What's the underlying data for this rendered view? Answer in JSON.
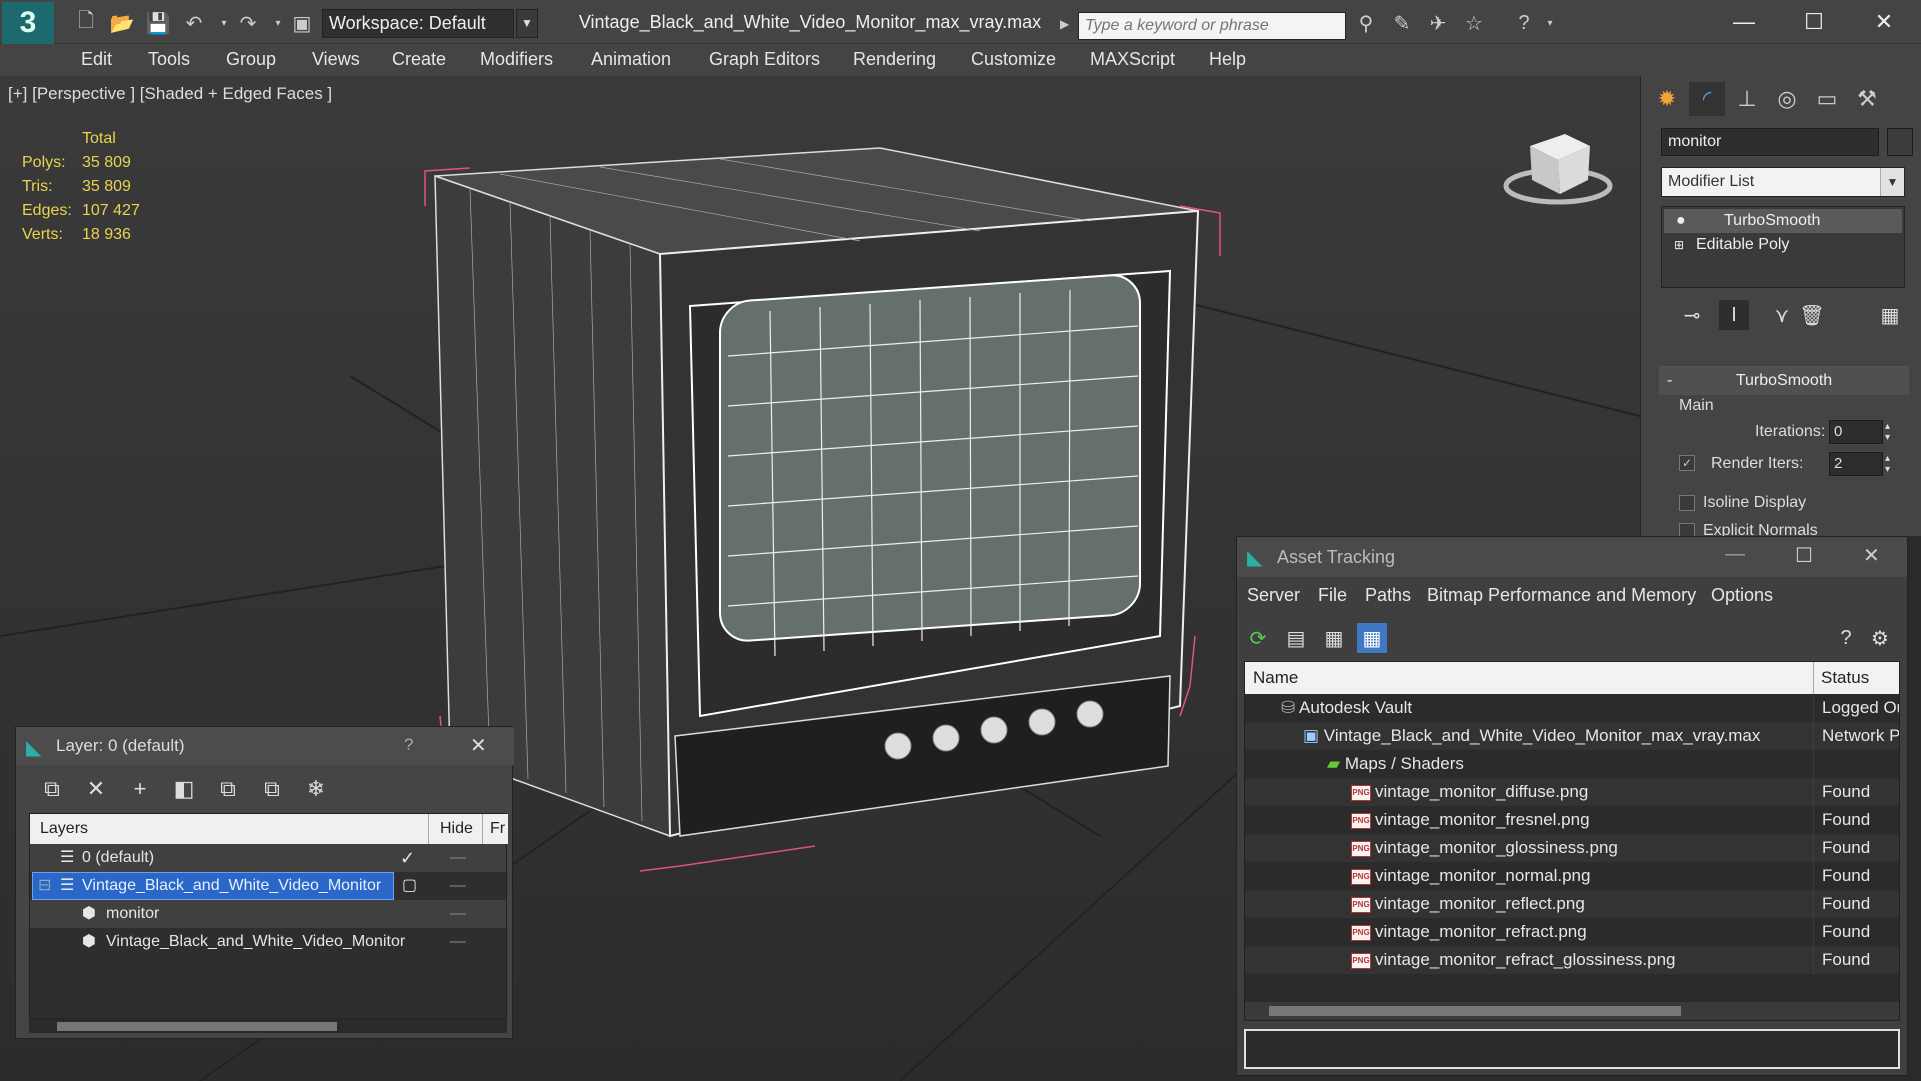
{
  "titlebar": {
    "workspace": "Workspace: Default",
    "title": "Vintage_Black_and_White_Video_Monitor_max_vray.max",
    "search_placeholder": "Type a keyword or phrase"
  },
  "menu": [
    "Edit",
    "Tools",
    "Group",
    "Views",
    "Create",
    "Modifiers",
    "Animation",
    "Graph Editors",
    "Rendering",
    "Customize",
    "MAXScript",
    "Help"
  ],
  "viewport": {
    "label": "[+] [Perspective ] [Shaded + Edged Faces ]",
    "stats": {
      "total_label": "Total",
      "polys_label": "Polys:",
      "polys": "35 809",
      "tris_label": "Tris:",
      "tris": "35 809",
      "edges_label": "Edges:",
      "edges": "107 427",
      "verts_label": "Verts:",
      "verts": "18 936"
    }
  },
  "command_panel": {
    "object_name": "monitor",
    "modifier_list": "Modifier List",
    "stack": [
      "TurboSmooth",
      "Editable Poly"
    ],
    "turbosmooth": {
      "title": "TurboSmooth",
      "collapse": "-",
      "main": "Main",
      "iterations_label": "Iterations:",
      "iterations": "0",
      "render_iters_label": "Render Iters:",
      "render_iters": "2",
      "isoline_label": "Isoline Display",
      "explicit_label": "Explicit Normals"
    }
  },
  "layer_panel": {
    "title": "Layer: 0 (default)",
    "help": "?",
    "col_layers": "Layers",
    "col_hide": "Hide",
    "col_fr": "Fr",
    "rows": [
      {
        "name": "0 (default)",
        "current": true
      },
      {
        "name": "Vintage_Black_and_White_Video_Monitor",
        "selected": true
      },
      {
        "name": "monitor"
      },
      {
        "name": "Vintage_Black_and_White_Video_Monitor"
      }
    ]
  },
  "asset_tracking": {
    "title": "Asset Tracking",
    "menu": [
      "Server",
      "File",
      "Paths",
      "Bitmap Performance and Memory",
      "Options"
    ],
    "col_name": "Name",
    "col_status": "Status",
    "rows": [
      {
        "name": "Autodesk Vault",
        "status": "Logged Out",
        "indent": 1,
        "icon": "vault"
      },
      {
        "name": "Vintage_Black_and_White_Video_Monitor_max_vray.max",
        "status": "Network Path",
        "indent": 2,
        "icon": "max"
      },
      {
        "name": "Maps / Shaders",
        "status": "",
        "indent": 3,
        "icon": "maps"
      },
      {
        "name": "vintage_monitor_diffuse.png",
        "status": "Found",
        "indent": 4,
        "icon": "png"
      },
      {
        "name": "vintage_monitor_fresnel.png",
        "status": "Found",
        "indent": 4,
        "icon": "png"
      },
      {
        "name": "vintage_monitor_glossiness.png",
        "status": "Found",
        "indent": 4,
        "icon": "png"
      },
      {
        "name": "vintage_monitor_normal.png",
        "status": "Found",
        "indent": 4,
        "icon": "png"
      },
      {
        "name": "vintage_monitor_reflect.png",
        "status": "Found",
        "indent": 4,
        "icon": "png"
      },
      {
        "name": "vintage_monitor_refract.png",
        "status": "Found",
        "indent": 4,
        "icon": "png"
      },
      {
        "name": "vintage_monitor_refract_glossiness.png",
        "status": "Found",
        "indent": 4,
        "icon": "png"
      }
    ],
    "png_badge": "PNG"
  },
  "colors": {
    "accent": "#1d6a6e",
    "stat_yellow": "#e8d44d",
    "selection": "#2a67c8",
    "wire_pink": "#e0508a"
  }
}
